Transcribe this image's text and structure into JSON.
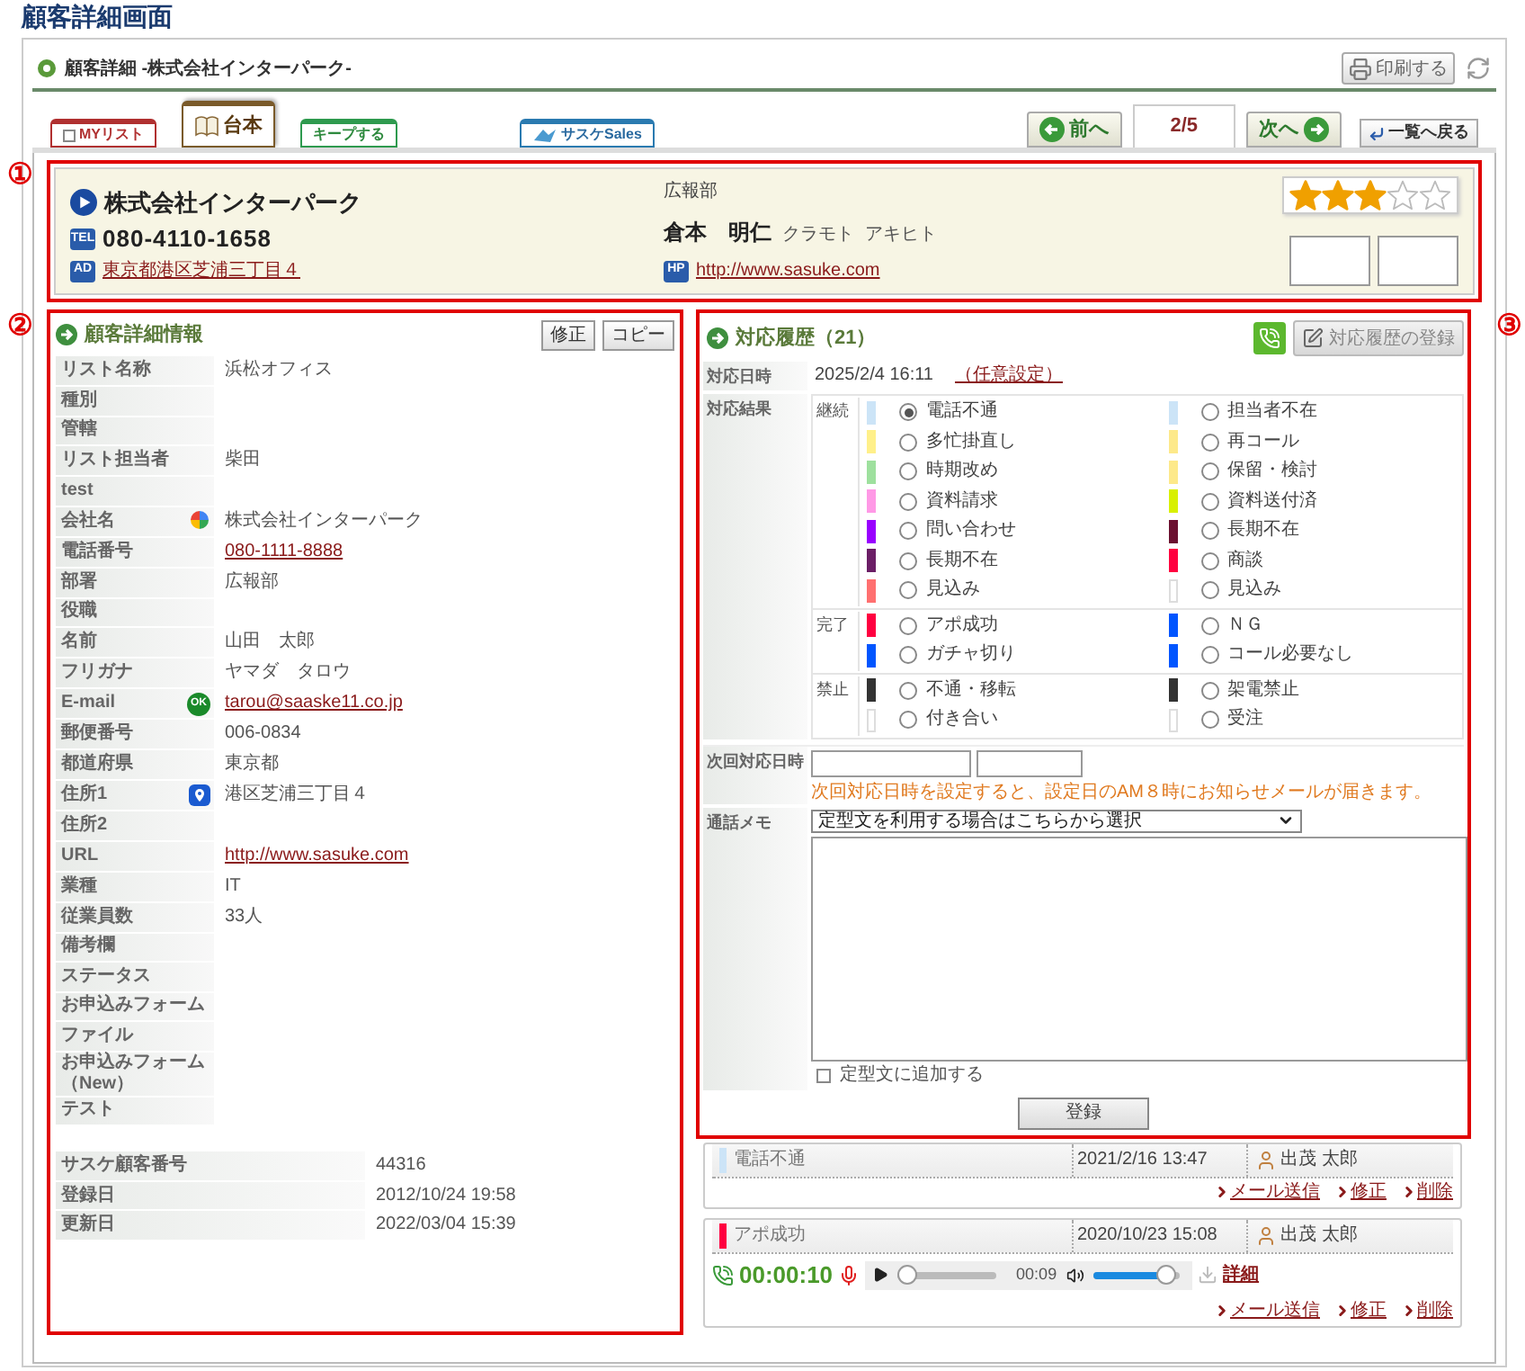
{
  "page_title": "顧客詳細画面",
  "header": {
    "title": "顧客詳細 -株式会社インターパーク-",
    "print_button": "印刷する"
  },
  "tabs": [
    {
      "label": "MYリスト",
      "kind": "mylist",
      "selected": false,
      "checked": false
    },
    {
      "label": "台本",
      "kind": "script",
      "selected": true
    },
    {
      "label": "キープする",
      "kind": "keep",
      "selected": false
    },
    {
      "label": "サスケSales",
      "kind": "sales",
      "selected": false
    }
  ],
  "nav": {
    "prev": "前へ",
    "page": "2/5",
    "next": "次へ",
    "back": "一覧へ戻る"
  },
  "annotations": [
    "①",
    "②",
    "③"
  ],
  "company_card": {
    "company": "株式会社インターパーク",
    "department": "広報部",
    "stars": 3,
    "phone_badge": "TEL",
    "phone": "080-4110-1658",
    "contact_name": "倉本　明仁",
    "kana_last": "クラモト",
    "kana_first": "アキヒト",
    "address_badge": "AD",
    "address": "東京都港区芝浦三丁目４",
    "url_badge": "HP",
    "url": "http://www.sasuke.com"
  },
  "details": {
    "title": "顧客詳細情報",
    "buttons": [
      "修正",
      "コピー"
    ],
    "rows": [
      {
        "label": "リスト名称",
        "value": "浜松オフィス"
      },
      {
        "label": "種別"
      },
      {
        "label": "管轄"
      },
      {
        "label": "リスト担当者",
        "value": "柴田"
      },
      {
        "label": "test"
      },
      {
        "label": "会社名",
        "value": "株式会社インターパーク",
        "kind": "company"
      },
      {
        "label": "電話番号",
        "value": "080-1111-8888",
        "kind": "link"
      },
      {
        "label": "部署",
        "value": "広報部"
      },
      {
        "label": "役職"
      },
      {
        "label": "名前",
        "value": "山田　太郎"
      },
      {
        "label": "フリガナ",
        "value": "ヤマダ　タロウ"
      },
      {
        "label": "E-mail",
        "value": "tarou@saaske11.co.jp",
        "kind": "email",
        "badge": "OK"
      },
      {
        "label": "郵便番号",
        "value": "006-0834"
      },
      {
        "label": "都道府県",
        "value": "東京都"
      },
      {
        "label": "住所1",
        "value": "港区芝浦三丁目４",
        "kind": "address"
      },
      {
        "label": "住所2"
      },
      {
        "label": "URL",
        "value": "http://www.sasuke.com",
        "kind": "link"
      },
      {
        "label": "業種",
        "value": "IT"
      },
      {
        "label": "従業員数",
        "value": "33人"
      },
      {
        "label": "備考欄"
      },
      {
        "label": "ステータス"
      },
      {
        "label": "お申込みフォーム"
      },
      {
        "label": "ファイル"
      },
      {
        "label": "お申込みフォーム（New）"
      },
      {
        "label": "テスト"
      }
    ],
    "system_rows": [
      {
        "label": "サスケ顧客番号",
        "value": "44316"
      },
      {
        "label": "登録日",
        "value": "2012/10/24 19:58"
      },
      {
        "label": "更新日",
        "value": "2022/03/04 15:39"
      }
    ]
  },
  "history": {
    "title": "対応履歴（21）",
    "register_button": "対応履歴の登録",
    "date_label": "対応日時",
    "date_value": "2025/2/4 16:11",
    "custom_link": "（任意設定）",
    "result_label": "対応結果",
    "groups": [
      {
        "label": "継続",
        "options": [
          {
            "label": "電話不通",
            "color": "#cce4f7",
            "selected": true
          },
          {
            "label": "担当者不在",
            "color": "#cce4f7",
            "selected": false
          },
          {
            "label": "多忙掛直し",
            "color": "#fff08a",
            "selected": false
          },
          {
            "label": "再コール",
            "color": "#fde98a",
            "selected": false
          },
          {
            "label": "時期改め",
            "color": "#9ee09e",
            "selected": false
          },
          {
            "label": "保留・検討",
            "color": "#fde98a",
            "selected": false
          },
          {
            "label": "資料請求",
            "color": "#ff99e6",
            "selected": false
          },
          {
            "label": "資料送付済",
            "color": "#d8f000",
            "selected": false
          },
          {
            "label": "問い合わせ",
            "color": "#9900ff",
            "selected": false
          },
          {
            "label": "長期不在",
            "color": "#6b1030",
            "selected": false
          },
          {
            "label": "長期不在",
            "color": "#6b1e66",
            "selected": false
          },
          {
            "label": "商談",
            "color": "#ff0040",
            "selected": false
          },
          {
            "label": "見込み",
            "color": "#ff7070",
            "selected": false
          },
          {
            "label": "見込み",
            "color": "#ffffff",
            "selected": false
          }
        ]
      },
      {
        "label": "完了",
        "options": [
          {
            "label": "アポ成功",
            "color": "#ff0040",
            "selected": false
          },
          {
            "label": "ＮＧ",
            "color": "#0055ff",
            "selected": false
          },
          {
            "label": "ガチャ切り",
            "color": "#0055ff",
            "selected": false
          },
          {
            "label": "コール必要なし",
            "color": "#0055ff",
            "selected": false
          }
        ]
      },
      {
        "label": "禁止",
        "options": [
          {
            "label": "不通・移転",
            "color": "#333333",
            "selected": false
          },
          {
            "label": "架電禁止",
            "color": "#333333",
            "selected": false
          },
          {
            "label": "付き合い",
            "color": "#ffffff",
            "selected": false
          },
          {
            "label": "受注",
            "color": "#ffffff",
            "selected": false
          }
        ]
      }
    ],
    "next_label": "次回対応日時",
    "next_note": "次回対応日時を設定すると、設定日のAM８時にお知らせメールが届きます。",
    "memo_label": "通話メモ",
    "template_select": "定型文を利用する場合はこちらから選択",
    "add_template": {
      "label": "定型文に追加する",
      "checked": false
    },
    "submit": "登録"
  },
  "entries": [
    {
      "result": "電話不通",
      "color": "#cce4f7",
      "datetime": "2021/2/16 13:47",
      "user": "出茂 太郎",
      "links": [
        "メール送信",
        "修正",
        "削除"
      ]
    },
    {
      "result": "アポ成功",
      "color": "#ff0040",
      "datetime": "2020/10/23 15:08",
      "user": "出茂 太郎",
      "recording": {
        "duration": "00:00:10",
        "position": "00:09",
        "progress": {
          "level": 0
        },
        "volume": {
          "level": 0.95
        },
        "detail_link": "詳細"
      },
      "links": [
        "メール送信",
        "修正",
        "削除"
      ]
    }
  ]
}
